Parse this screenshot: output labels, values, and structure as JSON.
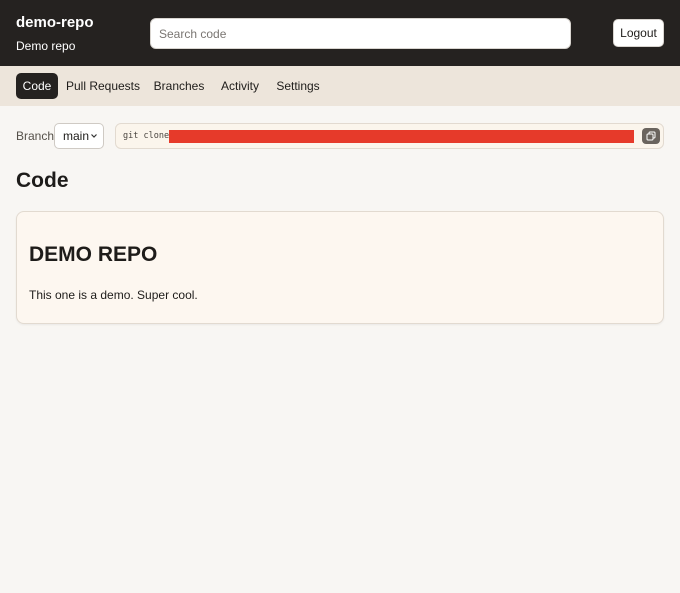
{
  "header": {
    "repo_name": "demo-repo",
    "repo_description": "Demo repo",
    "search_placeholder": "Search code",
    "logout_label": "Logout"
  },
  "nav": {
    "tabs": [
      {
        "label": "Code",
        "active": true
      },
      {
        "label": "Pull Requests",
        "active": false
      },
      {
        "label": "Branches",
        "active": false
      },
      {
        "label": "Activity",
        "active": false
      },
      {
        "label": "Settings",
        "active": false
      }
    ]
  },
  "toolbar": {
    "branch_label": "Branch",
    "branch_value": "main",
    "clone_label": "git clone",
    "clone_url": "",
    "copy_icon": "copy-icon"
  },
  "main": {
    "title": "Code",
    "readme": {
      "heading": "DEMO REPO",
      "body": "This one is a demo. Super cool."
    }
  },
  "colors": {
    "header_bg": "#252220",
    "nav_bg": "#ede5db",
    "page_bg": "#f8f6f3",
    "readme_bg": "#fdf7f0",
    "redaction": "#e63a2a"
  }
}
